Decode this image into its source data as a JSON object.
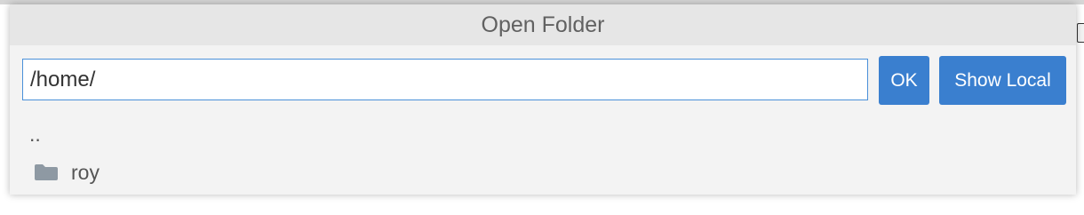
{
  "dialog": {
    "title": "Open Folder"
  },
  "path_input": {
    "value": "/home/"
  },
  "buttons": {
    "ok_label": "OK",
    "show_local_label": "Show Local"
  },
  "items": [
    {
      "label": "..",
      "icon": ""
    },
    {
      "label": "roy",
      "icon": "folder-icon"
    }
  ],
  "colors": {
    "accent": "#3a7fcf",
    "input_border": "#4a90d9",
    "folder_icon": "#8e99a3"
  }
}
